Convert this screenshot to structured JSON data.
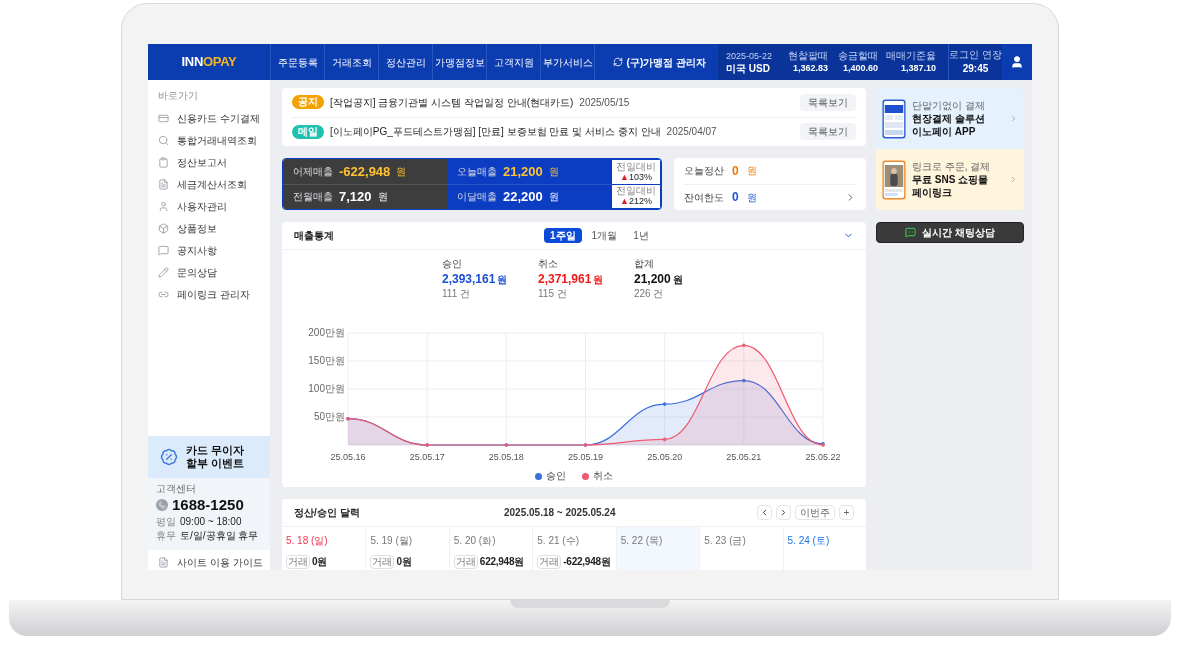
{
  "header": {
    "logo": [
      "INN",
      "O",
      "PAY"
    ],
    "nav": [
      {
        "label": "주문등록",
        "selected": false
      },
      {
        "label": "거래조회",
        "selected": false
      },
      {
        "label": "정산관리",
        "selected": false
      },
      {
        "label": "가맹점정보",
        "selected": false
      },
      {
        "label": "고객지원",
        "selected": false
      },
      {
        "label": "부가서비스",
        "selected": false
      }
    ],
    "account": "(구)가맹점 관리자",
    "exchange": {
      "date": "2025-05-22",
      "currency": "미국 USD",
      "columns": [
        {
          "label": "현찰팔때",
          "value": "1,362.83"
        },
        {
          "label": "송금할때",
          "value": "1,400.60"
        },
        {
          "label": "매매기준율",
          "value": "1,387.10"
        }
      ]
    },
    "session": {
      "label": "로그인 연장",
      "time": "29:45"
    }
  },
  "sidebar": {
    "heading": "바로가기",
    "items": [
      {
        "label": "신용카드 수기결제",
        "kind": "card"
      },
      {
        "label": "통합거래내역조회",
        "kind": "search"
      },
      {
        "label": "정산보고서",
        "kind": "clipboard"
      },
      {
        "label": "세금계산서조회",
        "kind": "document"
      },
      {
        "label": "사용자관리",
        "kind": "user"
      },
      {
        "label": "상품정보",
        "kind": "box"
      },
      {
        "label": "공지사항",
        "kind": "message"
      },
      {
        "label": "문의상담",
        "kind": "edit"
      },
      {
        "label": "페이링크 관리자",
        "kind": "link"
      }
    ],
    "promo": [
      "카드 무이자",
      "할부 이벤트"
    ],
    "support": {
      "title": "고객센터",
      "phone": "1688-1250",
      "hours": [
        {
          "label": "평일",
          "value": "09:00 ~ 18:00"
        },
        {
          "label": "휴무",
          "value": "토/일/공휴일 휴무"
        }
      ]
    },
    "guide": "사이트 이용 가이드"
  },
  "notices": [
    {
      "badge": "공지",
      "color": "#f5a100",
      "text": "[작업공지] 금융기관별 시스템 작업일정 안내(현대카드)",
      "date": "2025/05/15",
      "button": "목록보기"
    },
    {
      "badge": "메일",
      "color": "#1fc1b0",
      "text": "[이노페이PG_푸드테스트가맹점] [만료] 보증보험 만료 및 서비스 중지 안내",
      "date": "2025/04/07",
      "button": "목록보기"
    }
  ],
  "sales_summary": {
    "panels": [
      {
        "kind": "dark",
        "rows": [
          {
            "label": "어제매출",
            "value": "-622,948",
            "unit": "원",
            "highlight": true
          },
          {
            "label": "전월매출",
            "value": "7,120",
            "unit": "원",
            "highlight": false
          }
        ]
      },
      {
        "kind": "blue",
        "rows": [
          {
            "label": "오늘매출",
            "value": "21,200",
            "unit": "원",
            "highlight": true
          },
          {
            "label": "이달매출",
            "value": "22,200",
            "unit": "원",
            "highlight": false
          }
        ]
      }
    ],
    "comparisons": [
      {
        "label": "전일대비",
        "arrow": "▲",
        "value": "103",
        "unit": "%"
      },
      {
        "label": "전일대비",
        "arrow": "▲",
        "value": "212",
        "unit": "%"
      }
    ]
  },
  "settlement": [
    {
      "label": "오늘정산",
      "value": "0",
      "unit": "원",
      "color": "#f07a00"
    },
    {
      "label": "잔여한도",
      "value": "0",
      "unit": "원",
      "color": "#1a56db"
    }
  ],
  "sales_stats": {
    "title": "매출통계",
    "periods": [
      {
        "label": "1주일",
        "selected": true
      },
      {
        "label": "1개월",
        "selected": false
      },
      {
        "label": "1년",
        "selected": false
      }
    ],
    "totals": [
      {
        "label": "승인",
        "amount": "2,393,161",
        "unit": "원",
        "count": "111 건",
        "color": "#1a4fd6"
      },
      {
        "label": "취소",
        "amount": "2,371,961",
        "unit": "원",
        "count": "115 건",
        "color": "#f01818"
      },
      {
        "label": "합계",
        "amount": "21,200",
        "unit": "원",
        "count": "226 건",
        "color": "#111111"
      }
    ],
    "chart_data": {
      "type": "area",
      "grid": true,
      "legend": "bottom",
      "categories": [
        "25.05.16",
        "25.05.17",
        "25.05.18",
        "25.05.19",
        "25.05.20",
        "25.05.21",
        "25.05.22"
      ],
      "ylim": [
        0,
        200
      ],
      "yticks": [
        {
          "value": 50,
          "label": "50만원"
        },
        {
          "value": 100,
          "label": "100만원"
        },
        {
          "value": 150,
          "label": "150만원"
        },
        {
          "value": 200,
          "label": "200만원"
        }
      ],
      "series": [
        {
          "name": "승인",
          "color": "#3b6fe0",
          "values": [
            47,
            0,
            0,
            0,
            73,
            115,
            2
          ]
        },
        {
          "name": "취소",
          "color": "#ee5a6f",
          "values": [
            47,
            0,
            0,
            0,
            10,
            178,
            0
          ]
        }
      ]
    }
  },
  "calendar": {
    "title": "정산/승인 달력",
    "range": "2025.05.18 ~ 2025.05.24",
    "this_week": "이번주",
    "add": "+",
    "days": [
      {
        "label": "5. 18 (일)",
        "kind": "sun",
        "today": false,
        "tag": "거래",
        "amount": "0원"
      },
      {
        "label": "5. 19 (월)",
        "kind": "weekday",
        "today": false,
        "tag": "거래",
        "amount": "0원"
      },
      {
        "label": "5. 20 (화)",
        "kind": "weekday",
        "today": false,
        "tag": "거래",
        "amount": "622,948원"
      },
      {
        "label": "5. 21 (수)",
        "kind": "weekday",
        "today": false,
        "tag": "거래",
        "amount": "-622,948원"
      },
      {
        "label": "5. 22 (목)",
        "kind": "weekday",
        "today": true
      },
      {
        "label": "5. 23 (금)",
        "kind": "weekday",
        "today": false
      },
      {
        "label": "5. 24 (토)",
        "kind": "sat",
        "today": false
      }
    ]
  },
  "side_promos": [
    {
      "kind": "blue",
      "caption": "단말기없이 결제",
      "title": [
        "현장결제 솔루션",
        "이노페이 APP"
      ]
    },
    {
      "kind": "yellow",
      "caption": "링크로 주문, 결제",
      "title": [
        "무료 SNS 쇼핑몰",
        "페이링크"
      ]
    }
  ],
  "chat_button": "실시간 채팅상담"
}
